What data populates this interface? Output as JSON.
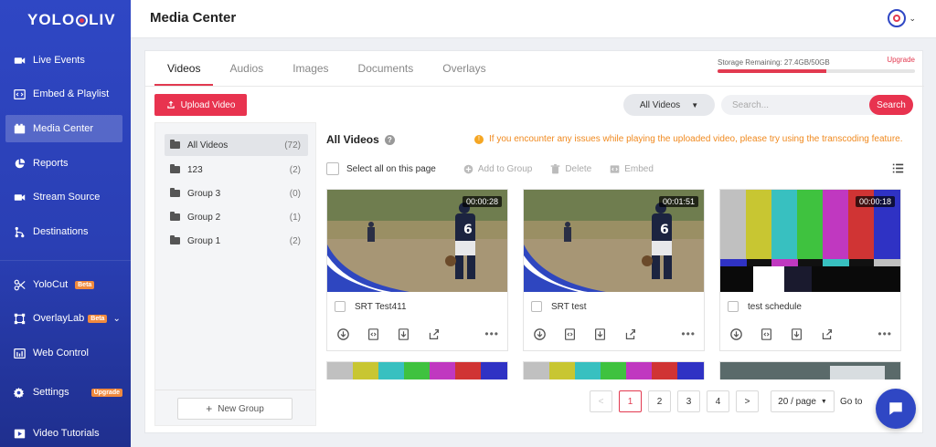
{
  "app": {
    "logo_left": "YOLO",
    "logo_right": "LIV"
  },
  "sidebar": {
    "items": [
      {
        "label": "Live Events",
        "icon": "video-camera-icon"
      },
      {
        "label": "Embed & Playlist",
        "icon": "embed-code-icon"
      },
      {
        "label": "Media Center",
        "icon": "media-folder-icon",
        "active": true
      },
      {
        "label": "Reports",
        "icon": "pie-chart-icon"
      },
      {
        "label": "Stream Source",
        "icon": "stream-camera-icon"
      },
      {
        "label": "Destinations",
        "icon": "destinations-icon"
      },
      {
        "label": "YoloCut",
        "icon": "scissors-icon",
        "badge": "Beta"
      },
      {
        "label": "OverlayLab",
        "icon": "overlay-frame-icon",
        "badge": "Beta"
      },
      {
        "label": "Web Control",
        "icon": "web-control-icon"
      },
      {
        "label": "Settings",
        "icon": "gear-icon",
        "badge": "Upgrade"
      },
      {
        "label": "Video Tutorials",
        "icon": "tutorial-play-icon"
      }
    ]
  },
  "header": {
    "title": "Media Center"
  },
  "tabs": [
    "Videos",
    "Audios",
    "Images",
    "Documents",
    "Overlays"
  ],
  "storage": {
    "label": "Storage Remaining: 27.4GB/50GB",
    "upgrade": "Upgrade",
    "used_fraction": 0.55
  },
  "toolbar": {
    "upload_label": "Upload Video",
    "filter_value": "All Videos",
    "search_placeholder": "Search...",
    "search_button": "Search"
  },
  "groups": [
    {
      "name": "All Videos",
      "count": "(72)",
      "active": true
    },
    {
      "name": "123",
      "count": "(2)"
    },
    {
      "name": "Group 3",
      "count": "(0)"
    },
    {
      "name": "Group 2",
      "count": "(1)"
    },
    {
      "name": "Group 1",
      "count": "(2)"
    }
  ],
  "new_group_label": "New Group",
  "content": {
    "title": "All Videos",
    "notice": "If you encounter any issues while playing the uploaded video, please try using the transcoding feature.",
    "select_all": "Select all on this page",
    "add_to_group": "Add to Group",
    "delete": "Delete",
    "embed": "Embed"
  },
  "videos": [
    {
      "name": "SRT Test411",
      "duration": "00:00:28",
      "thumb": "baseball"
    },
    {
      "name": "SRT test",
      "duration": "00:01:51",
      "thumb": "baseball"
    },
    {
      "name": "test schedule",
      "duration": "00:00:18",
      "thumb": "colorbars"
    }
  ],
  "pagination": {
    "prev": "<",
    "pages": [
      "1",
      "2",
      "3",
      "4"
    ],
    "next": ">",
    "page_size": "20 / page",
    "goto": "Go to",
    "current_page": "1"
  }
}
